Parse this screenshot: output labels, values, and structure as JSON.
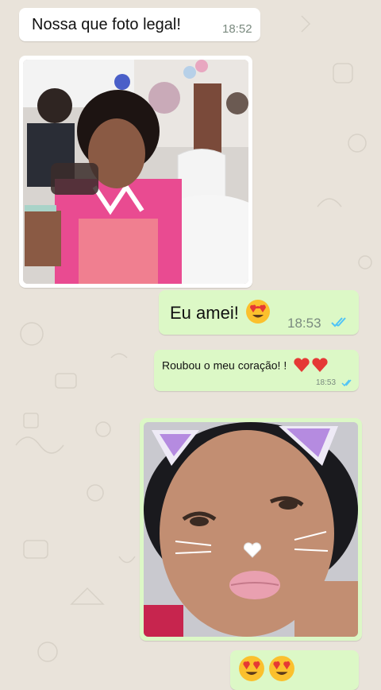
{
  "messages": {
    "m1": {
      "text": "Nossa que foto legal!",
      "time": "18:52"
    },
    "m2": {
      "text": "Eu amei!",
      "emoji": "smiling-face-with-heart-eyes",
      "time": "18:53",
      "status": "read"
    },
    "m3": {
      "text": "Roubou o meu coração! !",
      "emoji": "two-red-hearts",
      "time": "18:53",
      "status": "read"
    },
    "m4": {
      "emoji": "smiling-face-with-heart-eyes x2"
    }
  },
  "photos": {
    "party": {
      "description_icon": "party-photo"
    },
    "selfie": {
      "description_icon": "selfie-photo-with-cat-filter"
    }
  },
  "colors": {
    "chat_bg": "#e9e3da",
    "incoming": "#ffffff",
    "outgoing": "#dcf8c6",
    "read_ticks": "#4fc3f7",
    "time": "#7a8a7f"
  }
}
